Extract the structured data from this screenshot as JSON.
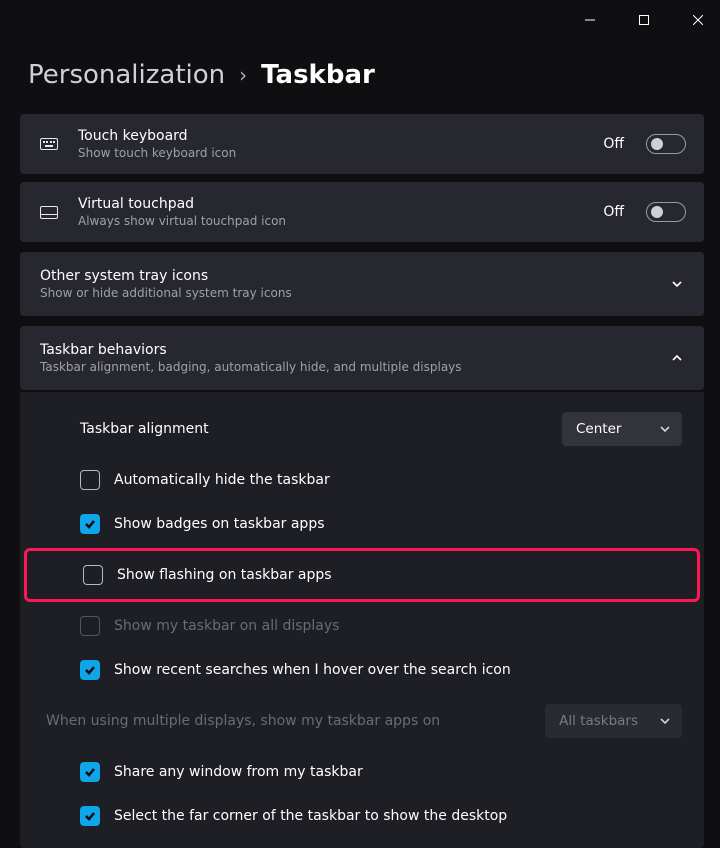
{
  "breadcrumb": {
    "parent": "Personalization",
    "current": "Taskbar"
  },
  "cards": {
    "touch_keyboard": {
      "title": "Touch keyboard",
      "subtitle": "Show touch keyboard icon",
      "state": "Off"
    },
    "virtual_touchpad": {
      "title": "Virtual touchpad",
      "subtitle": "Always show virtual touchpad icon",
      "state": "Off"
    }
  },
  "sections": {
    "other_icons": {
      "title": "Other system tray icons",
      "subtitle": "Show or hide additional system tray icons"
    },
    "behaviors": {
      "title": "Taskbar behaviors",
      "subtitle": "Taskbar alignment, badging, automatically hide, and multiple displays"
    }
  },
  "rows": {
    "alignment": {
      "label": "Taskbar alignment",
      "value": "Center"
    },
    "autohide": {
      "label": "Automatically hide the taskbar"
    },
    "badges": {
      "label": "Show badges on taskbar apps"
    },
    "flashing": {
      "label": "Show flashing on taskbar apps"
    },
    "all_displays": {
      "label": "Show my taskbar on all displays"
    },
    "recent_searches": {
      "label": "Show recent searches when I hover over the search icon"
    },
    "multi_display_apps": {
      "label": "When using multiple displays, show my taskbar apps on",
      "value": "All taskbars"
    },
    "share_window": {
      "label": "Share any window from my taskbar"
    },
    "far_corner": {
      "label": "Select the far corner of the taskbar to show the desktop"
    }
  }
}
